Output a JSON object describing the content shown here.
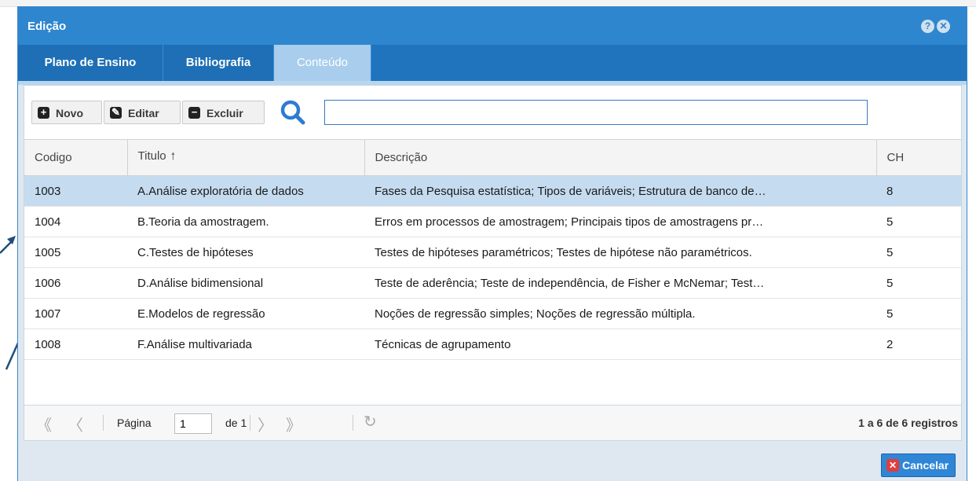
{
  "window": {
    "title": "Edição"
  },
  "tabs": [
    {
      "label": "Plano de Ensino",
      "active": false
    },
    {
      "label": "Bibliografia",
      "active": false
    },
    {
      "label": "Conteúdo",
      "active": true
    }
  ],
  "toolbar": {
    "novo_label": "Novo",
    "editar_label": "Editar",
    "excluir_label": "Excluir",
    "search_value": "",
    "search_placeholder": ""
  },
  "grid": {
    "columns": [
      "Codigo",
      "Titulo",
      "Descrição",
      "CH"
    ],
    "sorted_column": "Titulo",
    "rows": [
      {
        "codigo": "1003",
        "titulo": "A.Análise exploratória de dados",
        "descricao": "Fases da Pesquisa estatística; Tipos de variáveis; Estrutura de banco de…",
        "ch": "8",
        "selected": true
      },
      {
        "codigo": "1004",
        "titulo": "B.Teoria da amostragem.",
        "descricao": "Erros em processos de amostragem; Principais tipos de amostragens pr…",
        "ch": "5",
        "selected": false
      },
      {
        "codigo": "1005",
        "titulo": "C.Testes de hipóteses",
        "descricao": "Testes de hipóteses paramétricos; Testes de hipótese não paramétricos.",
        "ch": "5",
        "selected": false
      },
      {
        "codigo": "1006",
        "titulo": "D.Análise bidimensional",
        "descricao": "Teste de aderência; Teste de independência, de Fisher e McNemar; Test…",
        "ch": "5",
        "selected": false
      },
      {
        "codigo": "1007",
        "titulo": "E.Modelos de regressão",
        "descricao": "Noções de regressão simples; Noções de regressão múltipla.",
        "ch": "5",
        "selected": false
      },
      {
        "codigo": "1008",
        "titulo": "F.Análise multivariada",
        "descricao": "Técnicas de agrupamento",
        "ch": "2",
        "selected": false
      }
    ]
  },
  "pager": {
    "page_label": "Página",
    "page_value": "1",
    "of_label": "de 1",
    "count_text": "1 a 6 de 6 registros"
  },
  "footer": {
    "cancel_label": "Cancelar"
  },
  "colors": {
    "accent": "#2e86cf",
    "tab_bar": "#1f74bd",
    "selected_row": "#c5dcf0",
    "cancel_icon": "#e23c3c"
  }
}
